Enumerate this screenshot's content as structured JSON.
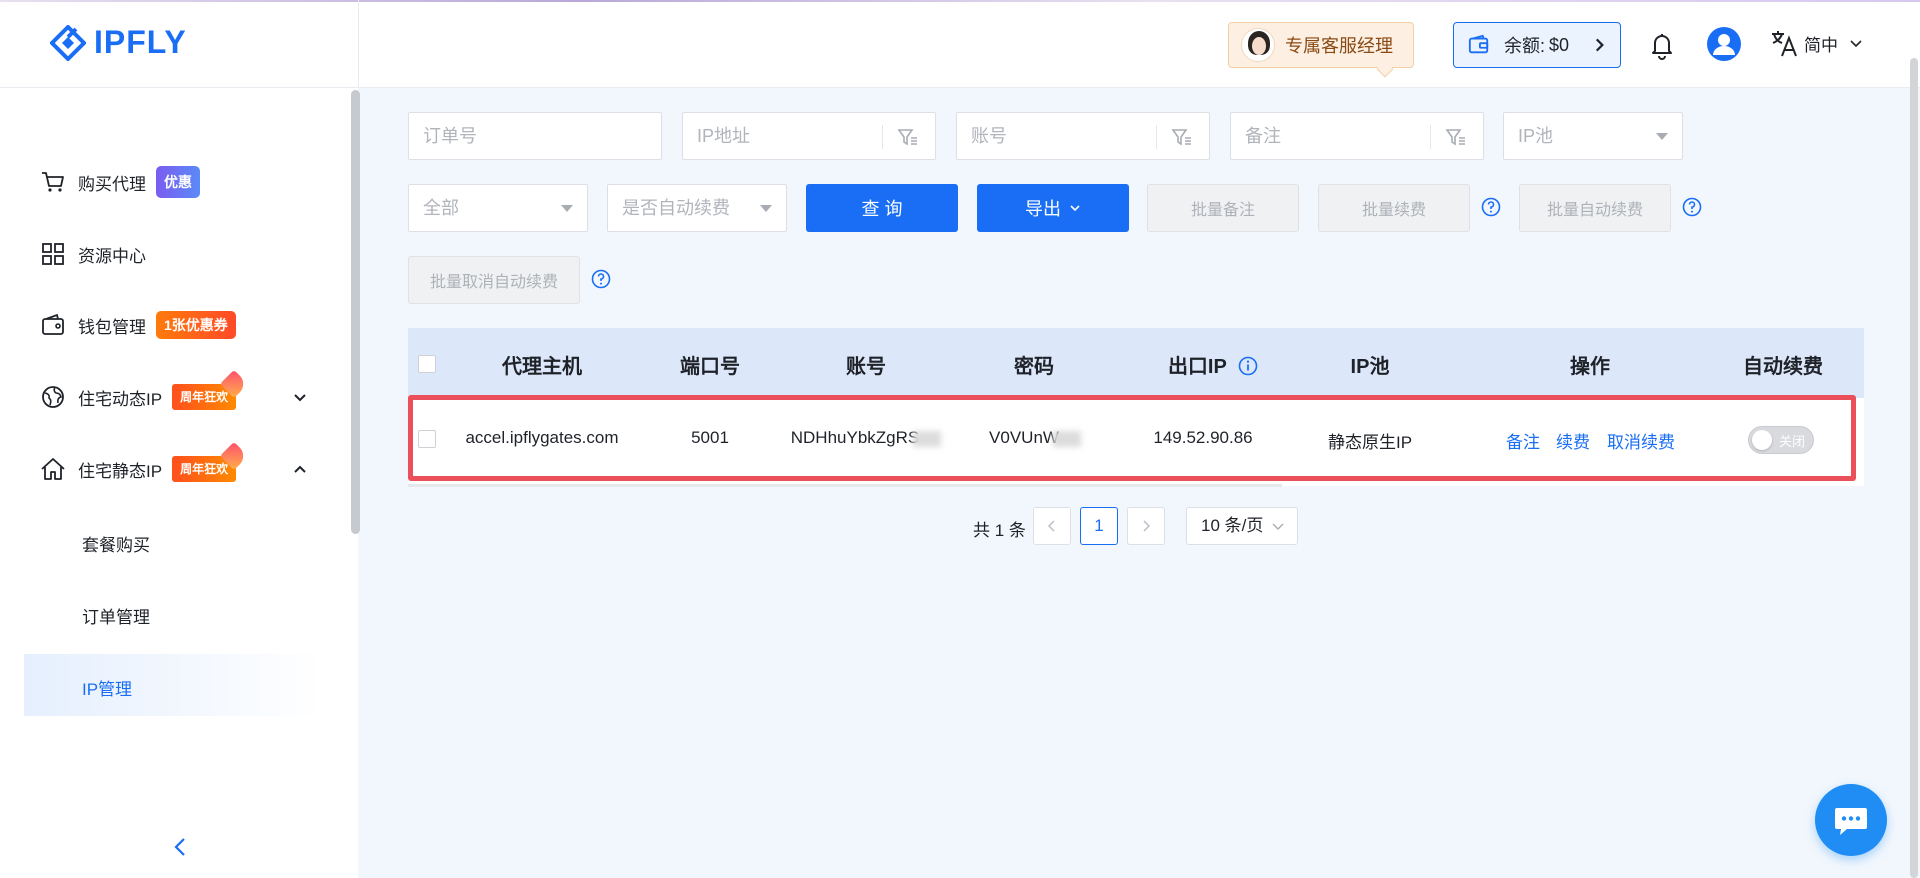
{
  "header": {
    "logo_text": "IPFLY",
    "manager_label": "专属客服经理",
    "balance_label": "余额:",
    "balance_value": "$0",
    "language": "简中"
  },
  "sidebar": {
    "items": [
      {
        "label": "购买代理",
        "badge": "优惠",
        "icon": "cart-icon"
      },
      {
        "label": "资源中心",
        "icon": "grid-icon"
      },
      {
        "label": "钱包管理",
        "badge": "1张优惠券",
        "icon": "wallet-icon"
      },
      {
        "label": "住宅动态IP",
        "badge": "周年狂欢",
        "icon": "globe-icon",
        "expanded": false
      },
      {
        "label": "住宅静态IP",
        "badge": "周年狂欢",
        "icon": "home-icon",
        "expanded": true
      }
    ],
    "sub_items": [
      "套餐购买",
      "订单管理",
      "IP管理"
    ],
    "active_sub": "IP管理"
  },
  "filters": {
    "order_no": "订单号",
    "ip_address": "IP地址",
    "account": "账号",
    "remark": "备注",
    "ip_pool": "IP池",
    "status": "全部",
    "auto_renew": "是否自动续费"
  },
  "buttons": {
    "query": "查 询",
    "export": "导出",
    "batch_remark": "批量备注",
    "batch_renew": "批量续费",
    "batch_auto_renew": "批量自动续费",
    "batch_cancel_auto_renew": "批量取消自动续费"
  },
  "table": {
    "columns": [
      "代理主机",
      "端口号",
      "账号",
      "密码",
      "出口IP",
      "IP池",
      "操作",
      "自动续费"
    ],
    "rows": [
      {
        "host": "accel.ipflygates.com",
        "port": "5001",
        "account": "NDHhuYbkZgRS",
        "password": "V0VUnW",
        "exit_ip": "149.52.90.86",
        "pool": "静态原生IP",
        "actions": [
          "备注",
          "续费",
          "取消续费"
        ],
        "auto_renew": "关闭"
      }
    ]
  },
  "pagination": {
    "total": "共 1 条",
    "current": "1",
    "page_size": "10 条/页"
  },
  "colors": {
    "primary": "#1a6ef5",
    "highlight": "#ea4f5a"
  }
}
